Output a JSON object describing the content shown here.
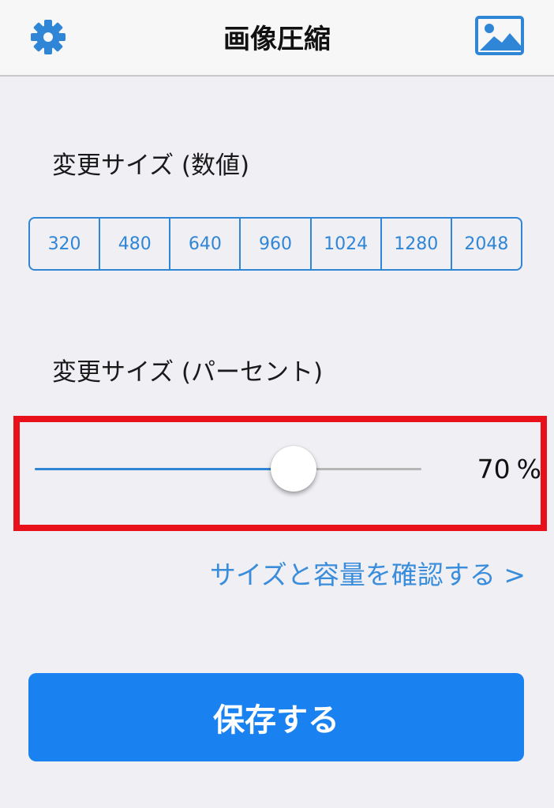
{
  "nav": {
    "title": "画像圧縮",
    "left_icon": "gear-icon",
    "right_icon": "photo-icon"
  },
  "size_numeric": {
    "label": "変更サイズ (数値)",
    "options": [
      "320",
      "480",
      "640",
      "960",
      "1024",
      "1280",
      "2048"
    ]
  },
  "size_percent": {
    "label": "変更サイズ (パーセント)",
    "slider_level": 0.67,
    "value": "70",
    "unit": "%"
  },
  "check_link": "サイズと容量を確認する >",
  "save_button": "保存する",
  "colors": {
    "accent": "#2f86d6",
    "button": "#1a82f0",
    "highlight": "#e8101a",
    "background": "#efeff4"
  }
}
